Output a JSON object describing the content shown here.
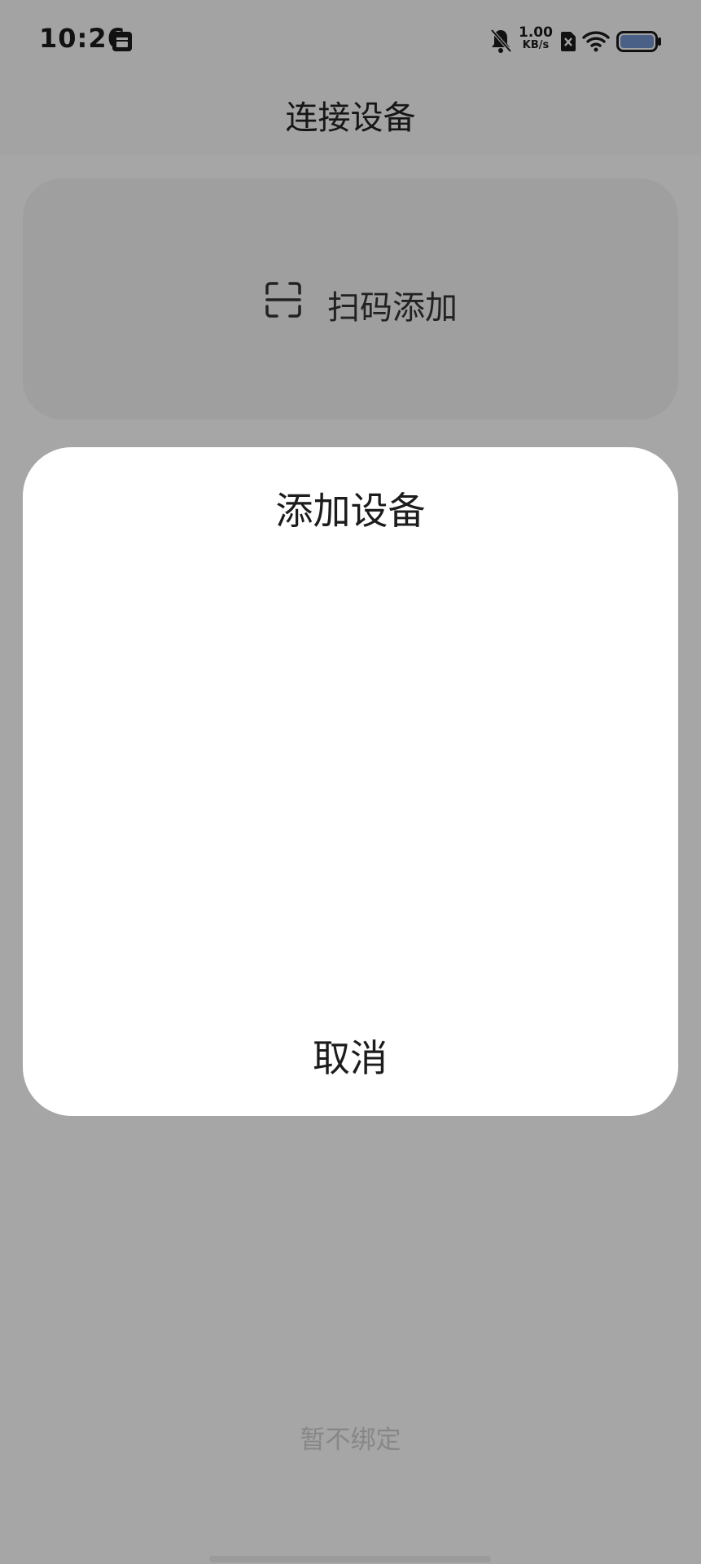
{
  "status_bar": {
    "time": "10:26",
    "net_speed_value": "1.00",
    "net_speed_unit": "KB/s",
    "icons": [
      "calendar-icon",
      "mute-bell-icon",
      "sim-card-icon",
      "wifi-icon",
      "battery-icon"
    ]
  },
  "header": {
    "title": "连接设备"
  },
  "scan_card": {
    "icon": "scan-frame-icon",
    "label": "扫码添加"
  },
  "footer": {
    "skip_label": "暂不绑定"
  },
  "dialog": {
    "title": "添加设备",
    "cancel_label": "取消"
  },
  "colors": {
    "background": "#f3f3f3",
    "card": "#ededed",
    "dialog": "#ffffff",
    "scrim": "rgba(0,0,0,0.33)",
    "skip_text": "#c9c9c9"
  }
}
